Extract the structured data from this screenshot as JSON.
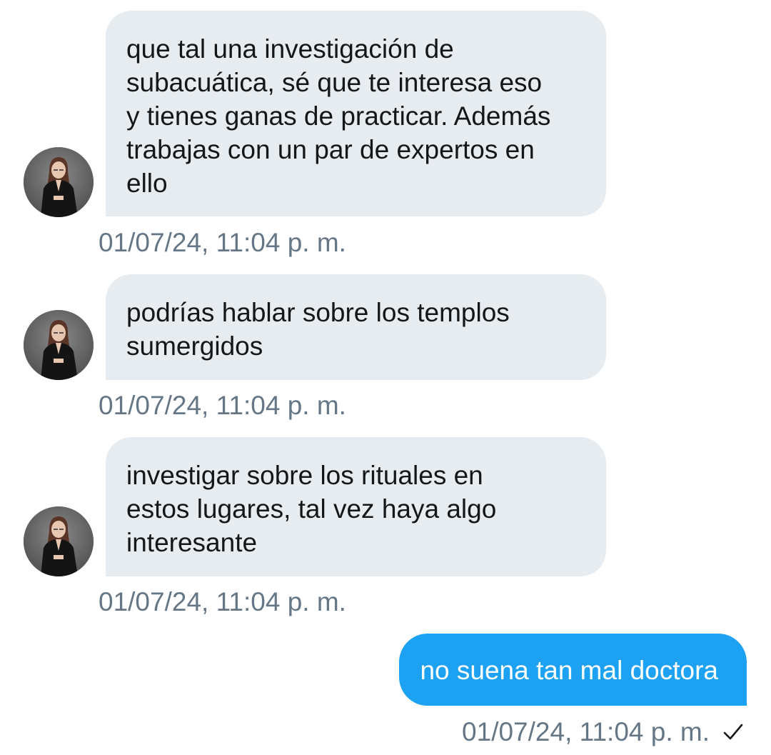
{
  "conversation": {
    "messages": [
      {
        "direction": "incoming",
        "text": "que tal una investigación de\nsubacuática, sé que te interesa eso\ny tienes ganas de practicar. Además\ntrabajas con un par de expertos en\nello",
        "timestamp": "01/07/24, 11:04 p. m.",
        "avatar_icon": "profile-photo-woman"
      },
      {
        "direction": "incoming",
        "text": "podrías hablar sobre los templos\nsumergidos",
        "timestamp": "01/07/24, 11:04 p. m.",
        "avatar_icon": "profile-photo-woman"
      },
      {
        "direction": "incoming",
        "text": "investigar sobre los rituales en\nestos lugares, tal vez haya algo\ninteresante",
        "timestamp": "01/07/24, 11:04 p. m.",
        "avatar_icon": "profile-photo-woman"
      },
      {
        "direction": "outgoing",
        "text": "no suena tan mal doctora",
        "timestamp": "01/07/24, 11:04 p. m.",
        "status_icon": "check-icon"
      }
    ]
  },
  "colors": {
    "incoming_bubble": "#e7ecf0",
    "outgoing_bubble": "#1da1f2",
    "timestamp_text": "#657786",
    "message_text": "#14171a"
  }
}
